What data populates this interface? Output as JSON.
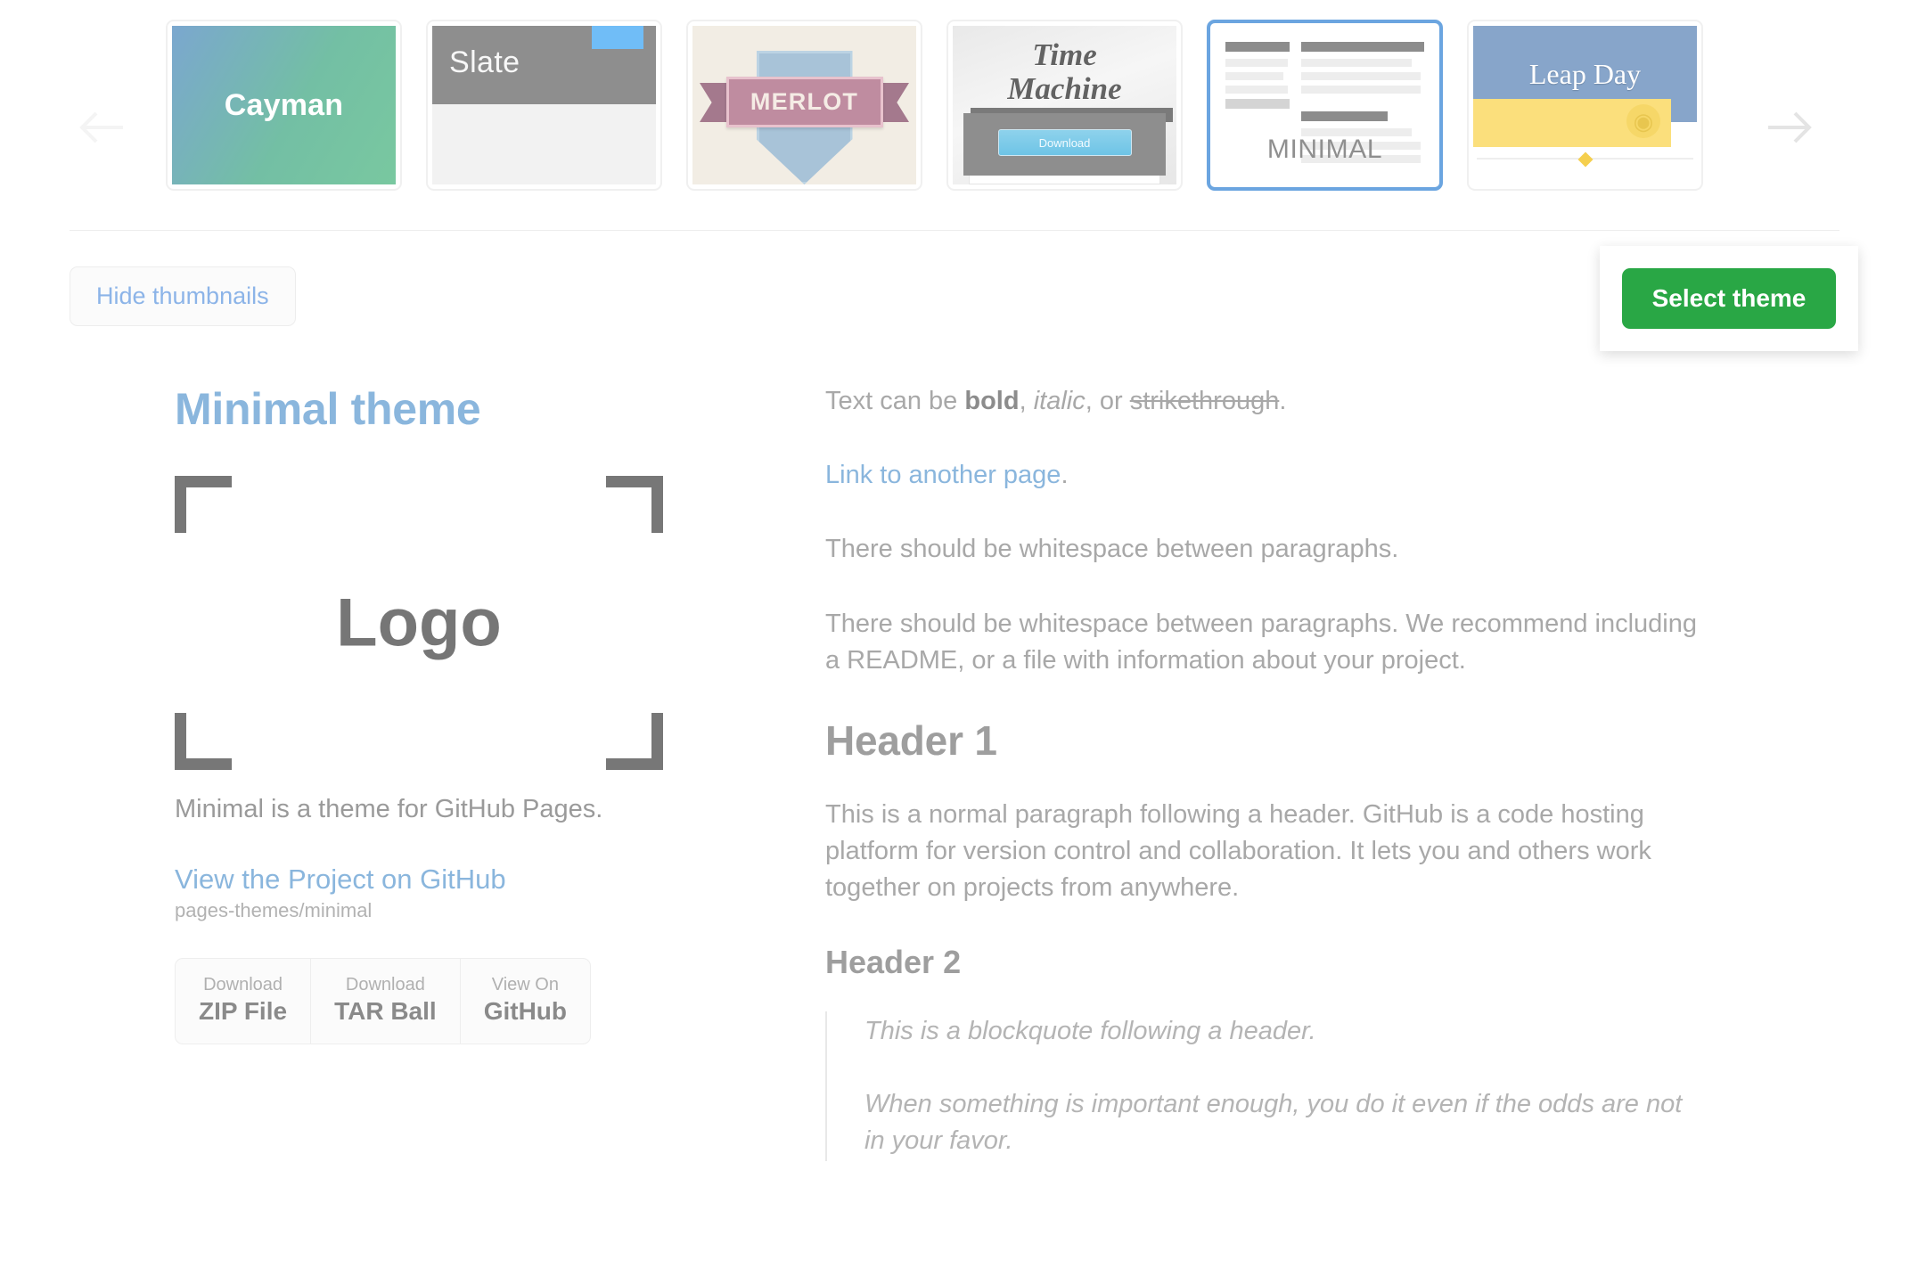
{
  "picker": {
    "prev_arrow_icon": "arrow-left-icon",
    "next_arrow_icon": "arrow-right-icon",
    "selected_theme": "Minimal",
    "thumbnails": [
      {
        "name": "Cayman",
        "label": "Cayman",
        "selected": false
      },
      {
        "name": "Slate",
        "label": "Slate",
        "selected": false
      },
      {
        "name": "Merlot",
        "label": "MERLOT",
        "selected": false
      },
      {
        "name": "Time Machine",
        "line1": "Time",
        "line2": "Machine",
        "button": "Download",
        "selected": false
      },
      {
        "name": "Minimal",
        "label": "MINIMAL",
        "selected": true
      },
      {
        "name": "Leap Day",
        "label": "Leap Day",
        "selected": false
      }
    ]
  },
  "controls": {
    "hide_thumbnails_label": "Hide thumbnails",
    "select_theme_label": "Select theme",
    "select_theme_color": "#29a745",
    "link_color": "#8ab6dd"
  },
  "preview": {
    "site_title": "Minimal theme",
    "logo_text": "Logo",
    "tagline": "Minimal is a theme for GitHub Pages.",
    "project_link": "View the Project on GitHub",
    "project_repo": "pages-themes/minimal",
    "buttons": [
      {
        "small": "Download",
        "big": "ZIP File"
      },
      {
        "small": "Download",
        "big": "TAR Ball"
      },
      {
        "small": "View On",
        "big": "GitHub"
      }
    ],
    "content": {
      "intro_prefix": "Text can be ",
      "intro_bold": "bold",
      "intro_mid1": ", ",
      "intro_italic": "italic",
      "intro_mid2": ", or ",
      "intro_strike": "strikethrough",
      "intro_suffix": ".",
      "link_text": "Link to another page",
      "link_suffix": ".",
      "para1": "There should be whitespace between paragraphs.",
      "para2": "There should be whitespace between paragraphs. We recommend including a README, or a file with information about your project.",
      "header1": "Header 1",
      "para3": "This is a normal paragraph following a header. GitHub is a code hosting platform for version control and collaboration. It lets you and others work together on projects from anywhere.",
      "header2": "Header 2",
      "quote1": "This is a blockquote following a header.",
      "quote2": "When something is important enough, you do it even if the odds are not in your favor."
    }
  }
}
